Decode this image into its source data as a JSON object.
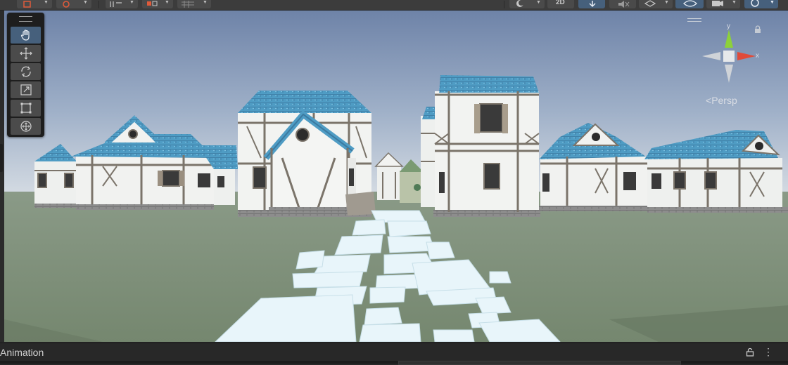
{
  "toolbar": {
    "view2d_label": "2D",
    "icons": [
      "draw-mode-icon",
      "gizmo-overlay-icon",
      "snap-icon",
      "grid-snap-icon",
      "shading-icon",
      "lighting-icon",
      "audio-icon",
      "effects-icon",
      "layers-icon",
      "visibility-icon",
      "camera-icon",
      "gizmos-icon"
    ]
  },
  "tools": [
    {
      "name": "hand-tool",
      "icon": "hand-icon",
      "active": true
    },
    {
      "name": "move-tool",
      "icon": "move-icon",
      "active": false
    },
    {
      "name": "rotate-tool",
      "icon": "rotate-icon",
      "active": false
    },
    {
      "name": "scale-tool",
      "icon": "scale-icon",
      "active": false
    },
    {
      "name": "rect-tool",
      "icon": "rect-icon",
      "active": false
    },
    {
      "name": "transform-tool",
      "icon": "transform-icon",
      "active": false
    }
  ],
  "gizmo": {
    "y_label": "y",
    "x_label": "x",
    "projection_label": "Persp",
    "colors": {
      "y": "#8dd13a",
      "x": "#e04b3a",
      "neutral": "#cfd3d8"
    }
  },
  "bottom_panel": {
    "title": "Animation",
    "icons": [
      "lock-icon",
      "kebab-menu-icon"
    ]
  },
  "colors": {
    "sky_top": "#6f84a8",
    "sky_bottom": "#c9d2dd",
    "ground": "#7e8f7b",
    "roof": "#4f9cc4",
    "wall": "#f2f3f1",
    "timber": "#7b746a",
    "accent": "#46607c"
  }
}
